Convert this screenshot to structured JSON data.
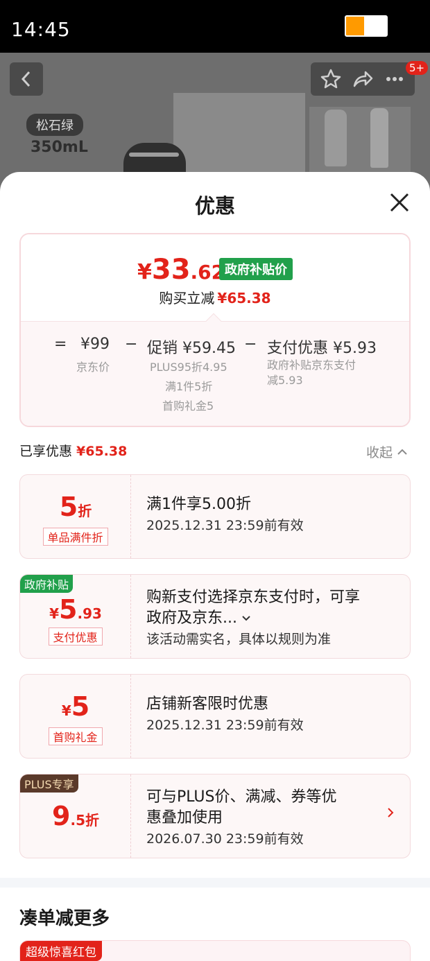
{
  "status_bar": {
    "time": "14:45"
  },
  "product_header": {
    "color_tag": "松石绿",
    "volume": "350mL",
    "more_badge": "5+"
  },
  "sheet": {
    "title": "优惠",
    "price": {
      "yen": "¥",
      "integer": "33",
      "decimal": ".62",
      "tag": "政府补贴价",
      "save_label": "购买立减",
      "save_amount": "¥65.38"
    },
    "formula": {
      "eq": "=",
      "jd_price": "¥99",
      "jd_price_label": "京东价",
      "minus1": "−",
      "promo": "促销 ¥59.45",
      "promo_lines": [
        "PLUS95折4.95",
        "满1件5折",
        "首购礼金5"
      ],
      "minus2": "−",
      "pay": "支付优惠 ¥5.93",
      "pay_lines": [
        "政府补贴京东支付",
        "减5.93"
      ]
    },
    "enjoyed": {
      "label": "已享优惠",
      "amount": "¥65.38",
      "collapse": "收起"
    },
    "discounts": [
      {
        "value_big": "5",
        "value_small": "折",
        "chip": "单品满件折",
        "line1": "满1件享5.00折",
        "line2": "2025.12.31 23:59前有效"
      },
      {
        "corner": "政府补贴",
        "yen": "¥",
        "value_big": "5",
        "value_small": ".93",
        "chip": "支付优惠",
        "line1": "购新支付选择京东支付时，可享",
        "line1b": "政府及京东...",
        "line2": "该活动需实名，具体以规则为准"
      },
      {
        "yen": "¥",
        "value_big": "5",
        "chip": "首购礼金",
        "line1": "店铺新客限时优惠",
        "line2": "2025.12.31 23:59前有效"
      },
      {
        "corner": "PLUS专享",
        "value_big": "9",
        "value_small": ".5折",
        "line1": "可与PLUS价、满减、券等优",
        "line1b": "惠叠加使用",
        "line2": "2026.07.30 23:59前有效"
      }
    ],
    "more_section": {
      "title": "凑单减更多",
      "card_tag": "超级惊喜红包"
    }
  },
  "colors": {
    "accent_red": "#e2231a",
    "gov_green": "#21a04b",
    "plus_brown": "#5a3a2a"
  },
  "icons": [
    "back-icon",
    "star-icon",
    "share-icon",
    "more-icon",
    "close-icon",
    "chevron-up-icon",
    "chevron-down-icon",
    "chevron-right-icon"
  ]
}
